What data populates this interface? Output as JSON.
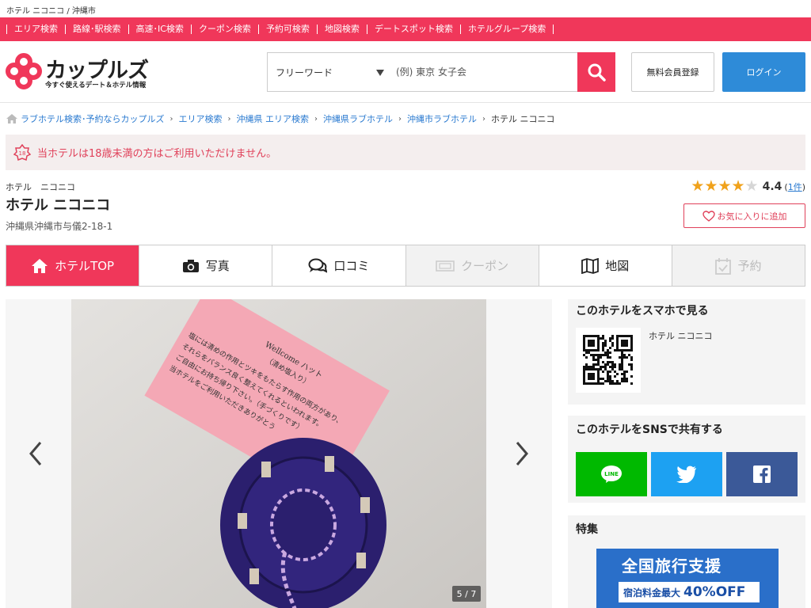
{
  "top_title": "ホテル ニコニコ / 沖縄市",
  "nav": [
    "エリア検索",
    "路線･駅検索",
    "高速･IC検索",
    "クーポン検索",
    "予約可検索",
    "地図検索",
    "デートスポット検索",
    "ホテルグループ検索"
  ],
  "logo": {
    "text": "カップルズ",
    "tagline": "今すぐ使えるデート＆ホテル情報"
  },
  "search": {
    "select_value": "フリーワード",
    "placeholder": "(例) 東京 女子会"
  },
  "register_label": "無料会員登録",
  "login_label": "ログイン",
  "breadcrumb": [
    "ラブホテル検索･予約ならカップルズ",
    "エリア検索",
    "沖縄県 エリア検索",
    "沖縄県ラブホテル",
    "沖縄市ラブホテル"
  ],
  "breadcrumb_current": "ホテル ニコニコ",
  "age_notice": "当ホテルは18歳未満の方はご利用いただけません。",
  "hotel": {
    "kana": "ホテル　ニコニコ",
    "name": "ホテル ニコニコ",
    "address": "沖縄県沖縄市与儀2-18-1",
    "rating": 4.4,
    "rating_text": "4.4",
    "review_count_prefix": "(",
    "review_count": "1件",
    "review_count_suffix": ")",
    "favorite_label": "お気に入りに追加"
  },
  "tabs": [
    {
      "label": "ホテルTOP",
      "icon": "home-icon",
      "state": "active"
    },
    {
      "label": "写真",
      "icon": "camera-icon",
      "state": "normal"
    },
    {
      "label": "口コミ",
      "icon": "speech-bubbles-icon",
      "state": "normal"
    },
    {
      "label": "クーポン",
      "icon": "ticket-icon",
      "state": "disabled"
    },
    {
      "label": "地図",
      "icon": "map-icon",
      "state": "normal"
    },
    {
      "label": "予約",
      "icon": "calendar-check-icon",
      "state": "disabled"
    }
  ],
  "gallery": {
    "counter": "5 / 7",
    "card_title": "Wellcome ハット",
    "card_sub": "（清め塩入り）",
    "card_lines": [
      "塩には清めの作用とツキをもたらす作用の両方があり、",
      "それらをバランス良く整えてくれるといわれます。",
      "ご自由にお持ち帰り下さい。（手づくりです）",
      "当ホテルをご利用いただきありがとう"
    ]
  },
  "sidebar": {
    "qr_title": "このホテルをスマホで見る",
    "qr_hotel_name": "ホテル ニコニコ",
    "sns_title": "このホテルをSNSで共有する",
    "line_label": "LINE",
    "feature_title": "特集",
    "banner_line1": "全国旅行支援",
    "banner_line2": "宿泊料金最大",
    "banner_percent": "40%OFF"
  },
  "colors": {
    "brand": "#f0375a",
    "login": "#2e8bd8",
    "line": "#00b900",
    "twitter": "#1da1f2",
    "facebook": "#3b5998",
    "star": "#f0a21c"
  }
}
